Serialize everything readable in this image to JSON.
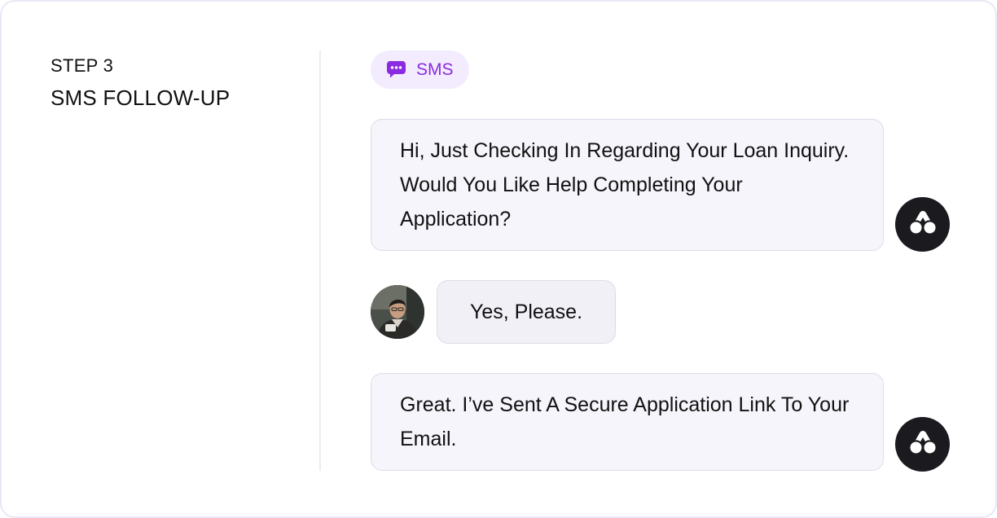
{
  "sidebar": {
    "step_label": "STEP 3",
    "step_title": "SMS FOLLOW-UP"
  },
  "channel": {
    "label": "SMS",
    "icon": "chat-bubble-icon",
    "accent_color": "#8a2be2",
    "badge_background": "#f3ecfe"
  },
  "messages": [
    {
      "sender": "agent",
      "avatar_icon": "brand-logo-icon",
      "text": "Hi, Just Checking In Regarding Your Loan Inquiry. Would You Like Help Completing Your Application?"
    },
    {
      "sender": "user",
      "avatar_icon": "user-photo",
      "text": "Yes, Please."
    },
    {
      "sender": "agent",
      "avatar_icon": "brand-logo-icon",
      "text": "Great. I’ve Sent A Secure Application Link To Your Email."
    }
  ]
}
